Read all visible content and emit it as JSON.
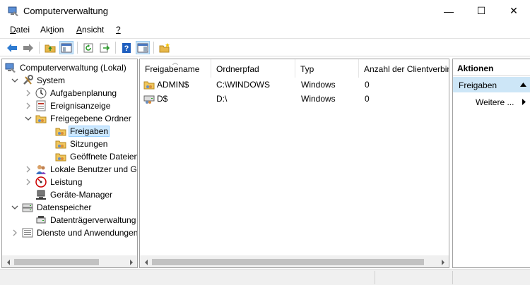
{
  "window": {
    "title": "Computerverwaltung",
    "minimize_glyph": "—",
    "maximize_glyph": "☐",
    "close_glyph": "✕"
  },
  "menu": [
    {
      "prefix": "",
      "underline": "D",
      "rest": "atei"
    },
    {
      "prefix": "Ak",
      "underline": "t",
      "rest": "ion"
    },
    {
      "prefix": "",
      "underline": "A",
      "rest": "nsicht"
    },
    {
      "prefix": "",
      "underline": "?",
      "rest": ""
    }
  ],
  "tree": [
    {
      "label": "Computerverwaltung (Lokal)",
      "icon": "computer-management-icon",
      "expander": "",
      "level": 0
    },
    {
      "label": "System",
      "icon": "tools-icon",
      "expander": "open",
      "level": 1
    },
    {
      "label": "Aufgabenplanung",
      "icon": "clock-icon",
      "expander": "closed",
      "level": 2
    },
    {
      "label": "Ereignisanzeige",
      "icon": "event-viewer-icon",
      "expander": "closed",
      "level": 2
    },
    {
      "label": "Freigegebene Ordner",
      "icon": "shared-folder-icon",
      "expander": "open",
      "level": 2
    },
    {
      "label": "Freigaben",
      "icon": "shared-folder-icon",
      "expander": "",
      "level": 3,
      "selected": true
    },
    {
      "label": "Sitzungen",
      "icon": "shared-folder-icon",
      "expander": "",
      "level": 3
    },
    {
      "label": "Geöffnete Dateien",
      "icon": "shared-folder-icon",
      "expander": "",
      "level": 3
    },
    {
      "label": "Lokale Benutzer und Gruppen",
      "icon": "users-icon",
      "expander": "closed",
      "level": 2
    },
    {
      "label": "Leistung",
      "icon": "performance-icon",
      "expander": "closed",
      "level": 2
    },
    {
      "label": "Geräte-Manager",
      "icon": "device-manager-icon",
      "expander": "",
      "level": 2
    },
    {
      "label": "Datenspeicher",
      "icon": "storage-icon",
      "expander": "open",
      "level": 1
    },
    {
      "label": "Datenträgerverwaltung",
      "icon": "disk-management-icon",
      "expander": "",
      "level": 2
    },
    {
      "label": "Dienste und Anwendungen",
      "icon": "services-icon",
      "expander": "closed",
      "level": 1
    }
  ],
  "list": {
    "columns": [
      "Freigabename",
      "Ordnerpfad",
      "Typ",
      "Anzahl der Clientverbindungen"
    ],
    "rows": [
      {
        "name": "ADMIN$",
        "path": "C:\\WINDOWS",
        "type": "Windows",
        "clients": "0",
        "icon": "share-icon"
      },
      {
        "name": "D$",
        "path": "D:\\",
        "type": "Windows",
        "clients": "0",
        "icon": "drive-share-icon"
      }
    ]
  },
  "actions": {
    "header": "Aktionen",
    "section": "Freigaben",
    "more": "Weitere ..."
  },
  "colors": {
    "accent": "#cde6f7",
    "selection": "#cce8ff"
  }
}
